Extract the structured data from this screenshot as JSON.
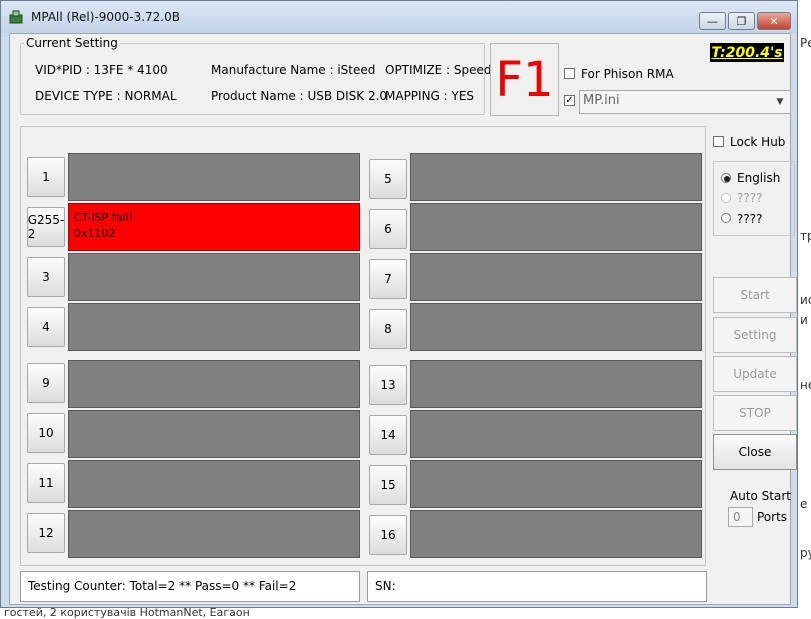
{
  "window": {
    "title": "MPAll (Rel)-9000-3.72.0B",
    "minimize_glyph": "—",
    "maximize_glyph": "❐",
    "close_glyph": "✕"
  },
  "current_setting": {
    "legend": "Current Setting",
    "vid_pid": "VID*PID : 13FE * 4100",
    "manufacture": "Manufacture Name : iSteed",
    "optimize": "OPTIMIZE : Speed",
    "device_type": "DEVICE TYPE : NORMAL",
    "product": "Product Name : USB DISK 2.0",
    "mapping": "MAPPING : YES"
  },
  "f1_label": "F1",
  "timer": "T:200.4's",
  "phison_rma": {
    "label": "For Phison RMA",
    "checked": false
  },
  "mp_ini": {
    "checked": true,
    "check_glyph": "✓",
    "value": "MP.ini",
    "arrow_glyph": "▼"
  },
  "ports_left": [
    {
      "button": "1",
      "status_line1": "",
      "status_line2": "",
      "fail": false
    },
    {
      "button": "G255-2",
      "status_line1": "CT-ISP fail!",
      "status_line2": "0x1102",
      "fail": true
    },
    {
      "button": "3",
      "status_line1": "",
      "status_line2": "",
      "fail": false
    },
    {
      "button": "4",
      "status_line1": "",
      "status_line2": "",
      "fail": false
    },
    {
      "button": "9",
      "status_line1": "",
      "status_line2": "",
      "fail": false
    },
    {
      "button": "10",
      "status_line1": "",
      "status_line2": "",
      "fail": false
    },
    {
      "button": "11",
      "status_line1": "",
      "status_line2": "",
      "fail": false
    },
    {
      "button": "12",
      "status_line1": "",
      "status_line2": "",
      "fail": false
    }
  ],
  "ports_right": [
    {
      "button": "5"
    },
    {
      "button": "6"
    },
    {
      "button": "7"
    },
    {
      "button": "8"
    },
    {
      "button": "13"
    },
    {
      "button": "14"
    },
    {
      "button": "15"
    },
    {
      "button": "16"
    }
  ],
  "lock_hub": {
    "label": "Lock Hub",
    "checked": false
  },
  "language": [
    {
      "label": "English",
      "selected": true,
      "enabled": true
    },
    {
      "label": "????",
      "selected": false,
      "enabled": false
    },
    {
      "label": "????",
      "selected": false,
      "enabled": true
    }
  ],
  "actions": {
    "start": "Start",
    "setting": "Setting",
    "update": "Update",
    "stop": "STOP",
    "close": "Close"
  },
  "auto_start": {
    "label": "Auto Start",
    "value": "0",
    "ports_label": "Ports"
  },
  "status": {
    "testing_counter": "Testing Counter: Total=2 ** Pass=0 ** Fail=2",
    "sn_label": "SN:"
  },
  "background_fragments": {
    "right": [
      "Ре",
      "тр",
      "ис",
      "и",
      "не",
      "е",
      "ру"
    ],
    "bottom": "гостей, 2 користувачів     HotmanNet, Eагаон"
  },
  "colors": {
    "fail_red": "#ff0000",
    "port_gray": "#808080",
    "timer_yellow": "#ffff00",
    "f1_red": "#f00000"
  }
}
